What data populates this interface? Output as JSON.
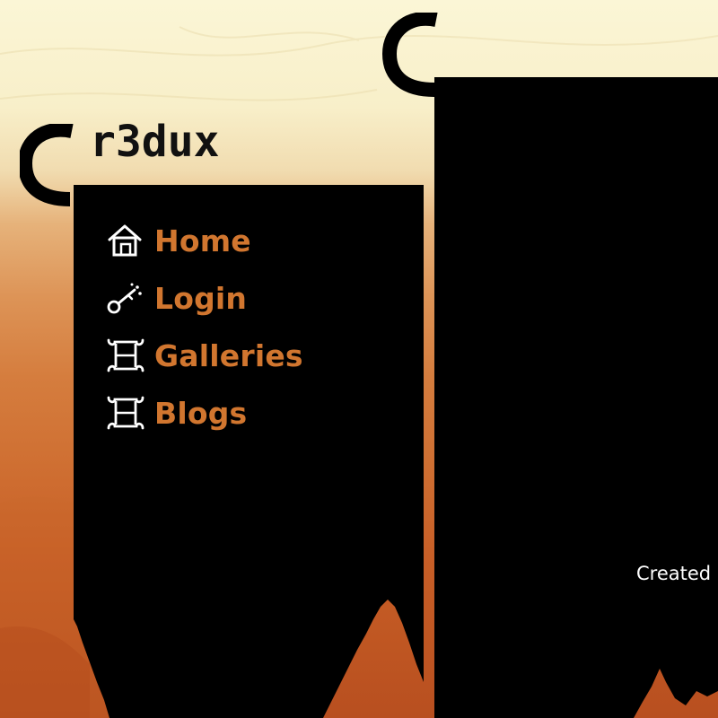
{
  "site": {
    "logo_text": "r3dux"
  },
  "nav": {
    "items": [
      {
        "label": "Home",
        "icon": "house-icon"
      },
      {
        "label": "Login",
        "icon": "key-icon"
      },
      {
        "label": "Galleries",
        "icon": "scroll-icon"
      },
      {
        "label": "Blogs",
        "icon": "scroll-icon"
      }
    ]
  },
  "content": {
    "footer_text": "Created"
  },
  "colors": {
    "nav_text": "#d1762f",
    "banner": "#000000",
    "background_top": "#fbf6d6",
    "background_bottom": "#b84f20"
  }
}
